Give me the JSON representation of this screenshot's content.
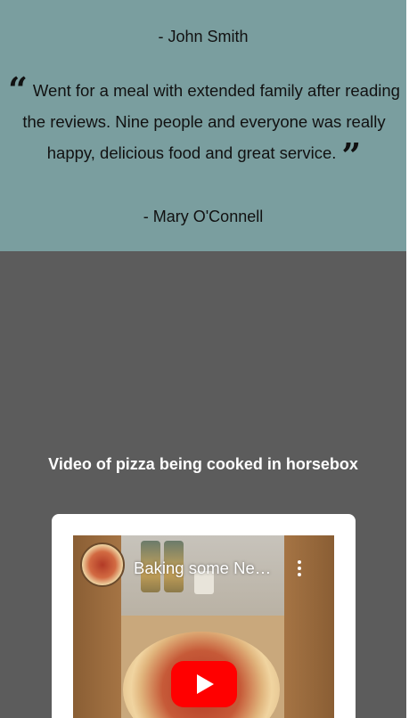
{
  "testimonials": {
    "author_1": "- John Smith",
    "quote_open": "“",
    "quote_text": "Went for a meal with extended family after reading the reviews. Nine people and everyone was really happy, delicious food and great service.",
    "quote_close": "”",
    "author_2": "- Mary O'Connell",
    "background_color": "#7a9e9f"
  },
  "video_section": {
    "title": "Video of pizza being cooked in horsebox",
    "background_color": "#5c5c5c",
    "player": {
      "video_title": "Baking some Ne…",
      "more_icon": "more-vert-icon",
      "play_icon": "play-icon",
      "play_button_color": "#ff0000"
    }
  }
}
